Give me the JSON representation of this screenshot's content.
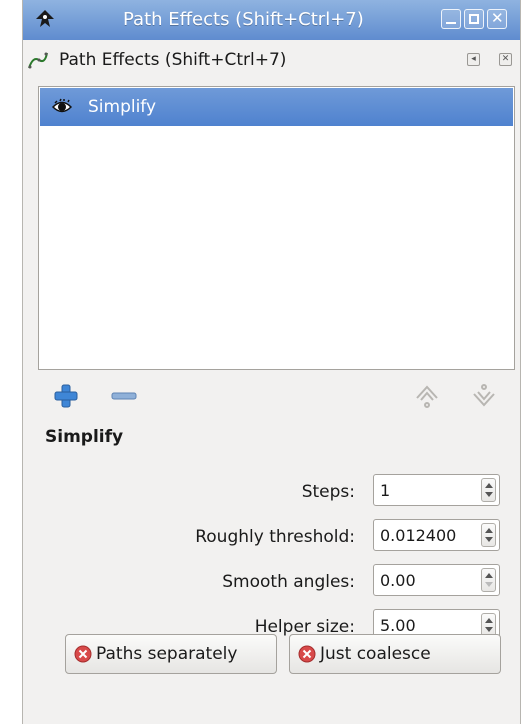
{
  "window": {
    "title": "Path Effects  (Shift+Ctrl+7)"
  },
  "dock": {
    "title": "Path Effects  (Shift+Ctrl+7)",
    "iconify_glyph": "◂",
    "close_glyph": "✕"
  },
  "effects_list": {
    "items": [
      {
        "label": "Simplify",
        "visible": true,
        "selected": true
      }
    ]
  },
  "current_effect": {
    "title": "Simplify"
  },
  "params": [
    {
      "label": "Steps:",
      "value": "1"
    },
    {
      "label": "Roughly threshold:",
      "value": "0.012400"
    },
    {
      "label": "Smooth angles:",
      "value": "0.00"
    },
    {
      "label": "Helper size:",
      "value": "5.00"
    }
  ],
  "buttons": {
    "paths_separately": "Paths separately",
    "just_coalesce": "Just coalesce"
  },
  "colors": {
    "titlebar": "#6f9ad8",
    "selection": "#5b8bd4",
    "add": "#3f86d6",
    "stop": "#d84a4a"
  }
}
